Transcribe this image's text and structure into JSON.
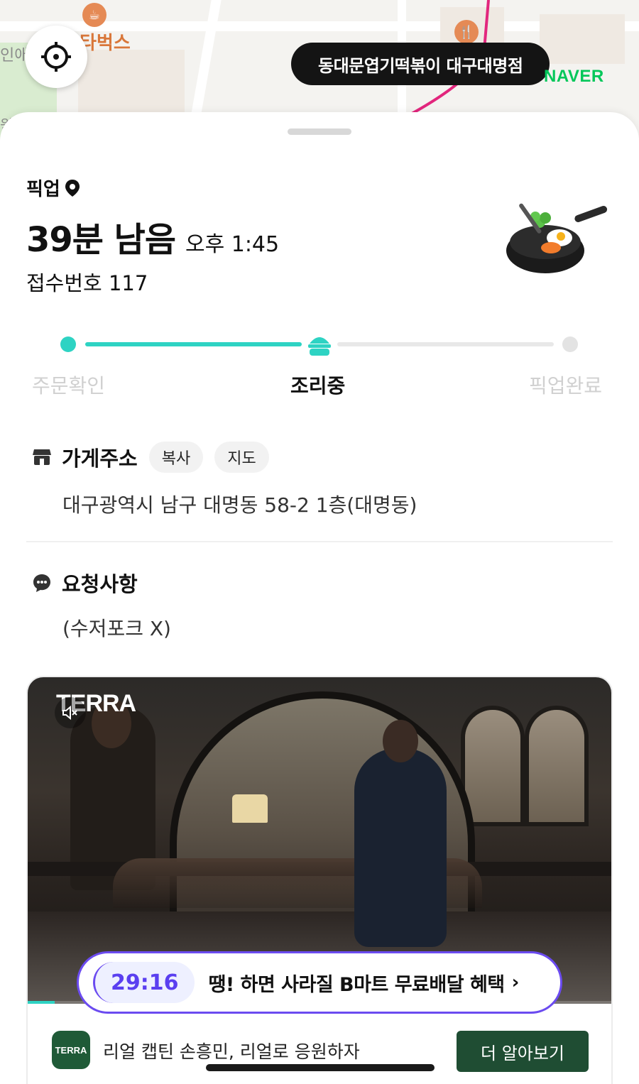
{
  "map": {
    "labels": {
      "starbucks": "타벅스",
      "left_edge": "인애",
      "left_edge_2": "원"
    },
    "store_pill": "동대문엽기떡볶이 대구대명점",
    "provider": "NAVER"
  },
  "pickup": {
    "label": "픽업",
    "remaining": "39분 남음",
    "eta": "오후 1:45",
    "order_number": "접수번호 117"
  },
  "progress": {
    "steps": [
      {
        "label": "주문확인",
        "state": "done"
      },
      {
        "label": "조리중",
        "state": "active"
      },
      {
        "label": "픽업완료",
        "state": "pending"
      }
    ]
  },
  "store_address": {
    "title": "가게주소",
    "copy_label": "복사",
    "map_label": "지도",
    "address": "대구광역시 남구 대명동 58-2 1층(대명동)"
  },
  "request": {
    "title": "요청사항",
    "text": "(수저포크 X)"
  },
  "ad": {
    "brand": "TERRA",
    "caption": "리얼 캡틴 손흥민, 리얼로 응원하자",
    "cta": "더 알아보기",
    "logo_text": "TERRA",
    "video_progress": 0.046
  },
  "banner": {
    "timer": "29:16",
    "text": "땡! 하면 사라질 B마트 무료배달 혜택",
    "arrow": "›"
  },
  "colors": {
    "accent_teal": "#2ed3c3",
    "banner_purple": "#6b4bf0",
    "naver_green": "#03c75a",
    "cta_green": "#1f4d33"
  }
}
